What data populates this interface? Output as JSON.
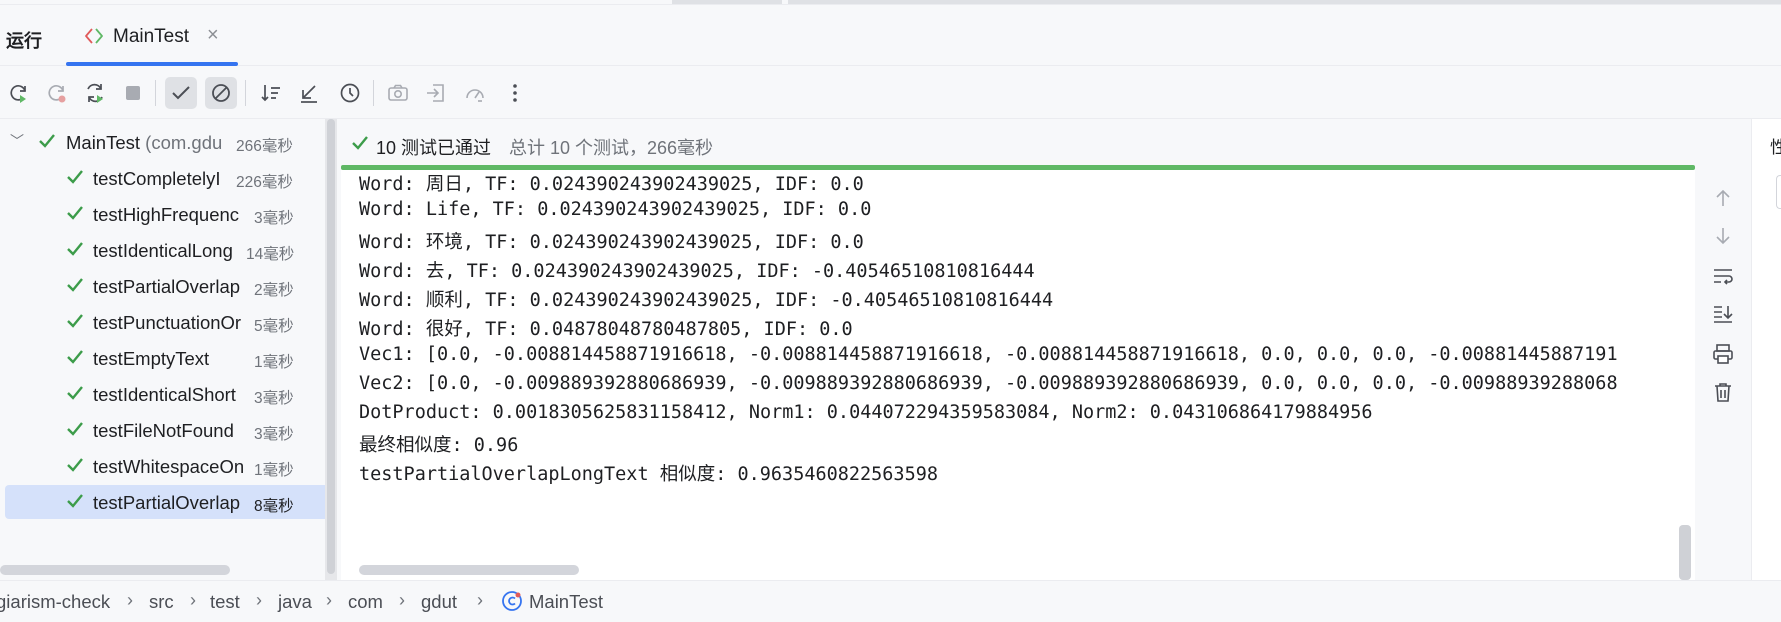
{
  "header": {
    "panel_title": "运行",
    "tab_label": "MainTest"
  },
  "toolbar": {
    "buttons": [
      "rerun-icon",
      "rerun-failed-icon",
      "toggle-auto-test-icon",
      "stop-icon",
      "show-passed-icon",
      "show-ignored-icon",
      "sort-alphabetically-icon",
      "sort-by-duration-icon",
      "history-icon",
      "screenshot-icon",
      "import-tests-icon",
      "coverage-icon",
      "more-icon"
    ]
  },
  "tree": {
    "root": {
      "name": "MainTest",
      "sub": " (com.gdu",
      "time": "266毫秒"
    },
    "items": [
      {
        "name": "testCompletelyI",
        "time": "226毫秒"
      },
      {
        "name": "testHighFrequenc",
        "time": "3毫秒"
      },
      {
        "name": "testIdenticalLong",
        "time": "14毫秒"
      },
      {
        "name": "testPartialOverlap",
        "time": "2毫秒"
      },
      {
        "name": "testPunctuationOr",
        "time": "5毫秒"
      },
      {
        "name": "testEmptyText",
        "time": "1毫秒"
      },
      {
        "name": "testIdenticalShort",
        "time": "3毫秒"
      },
      {
        "name": "testFileNotFound",
        "time": "3毫秒"
      },
      {
        "name": "testWhitespaceOn",
        "time": "1毫秒"
      },
      {
        "name": "testPartialOverlap",
        "time": "8毫秒"
      }
    ]
  },
  "output": {
    "passed": "10 测试已通过",
    "total": "总计 10 个测试，266毫秒",
    "lines": [
      "Word: 周日, TF: 0.024390243902439025, IDF: 0.0",
      "Word: Life, TF: 0.024390243902439025, IDF: 0.0",
      "Word: 环境, TF: 0.024390243902439025, IDF: 0.0",
      "Word: 去, TF: 0.024390243902439025, IDF: -0.40546510810816444",
      "Word: 顺利, TF: 0.024390243902439025, IDF: -0.40546510810816444",
      "Word: 很好, TF: 0.04878048780487805, IDF: 0.0",
      "Vec1: [0.0, -0.008814458871916618, -0.008814458871916618, -0.008814458871916618, 0.0, 0.0, 0.0, -0.00881445887191",
      "Vec2: [0.0, -0.009889392880686939, -0.009889392880686939, -0.009889392880686939, 0.0, 0.0, 0.0, -0.00988939288068",
      "DotProduct: 0.0018305625831158412, Norm1: 0.044072294359583084, Norm2: 0.043106864179884956",
      "最终相似度: 0.96",
      "testPartialOverlapLongText 相似度: 0.9635460822563598"
    ]
  },
  "right_tab": "性",
  "breadcrumb": [
    "giarism-check",
    "src",
    "test",
    "java",
    "com",
    "gdut",
    "MainTest"
  ],
  "colors": {
    "accent": "#3574f0",
    "success": "#5fb865",
    "selection": "#d5e1fa"
  }
}
